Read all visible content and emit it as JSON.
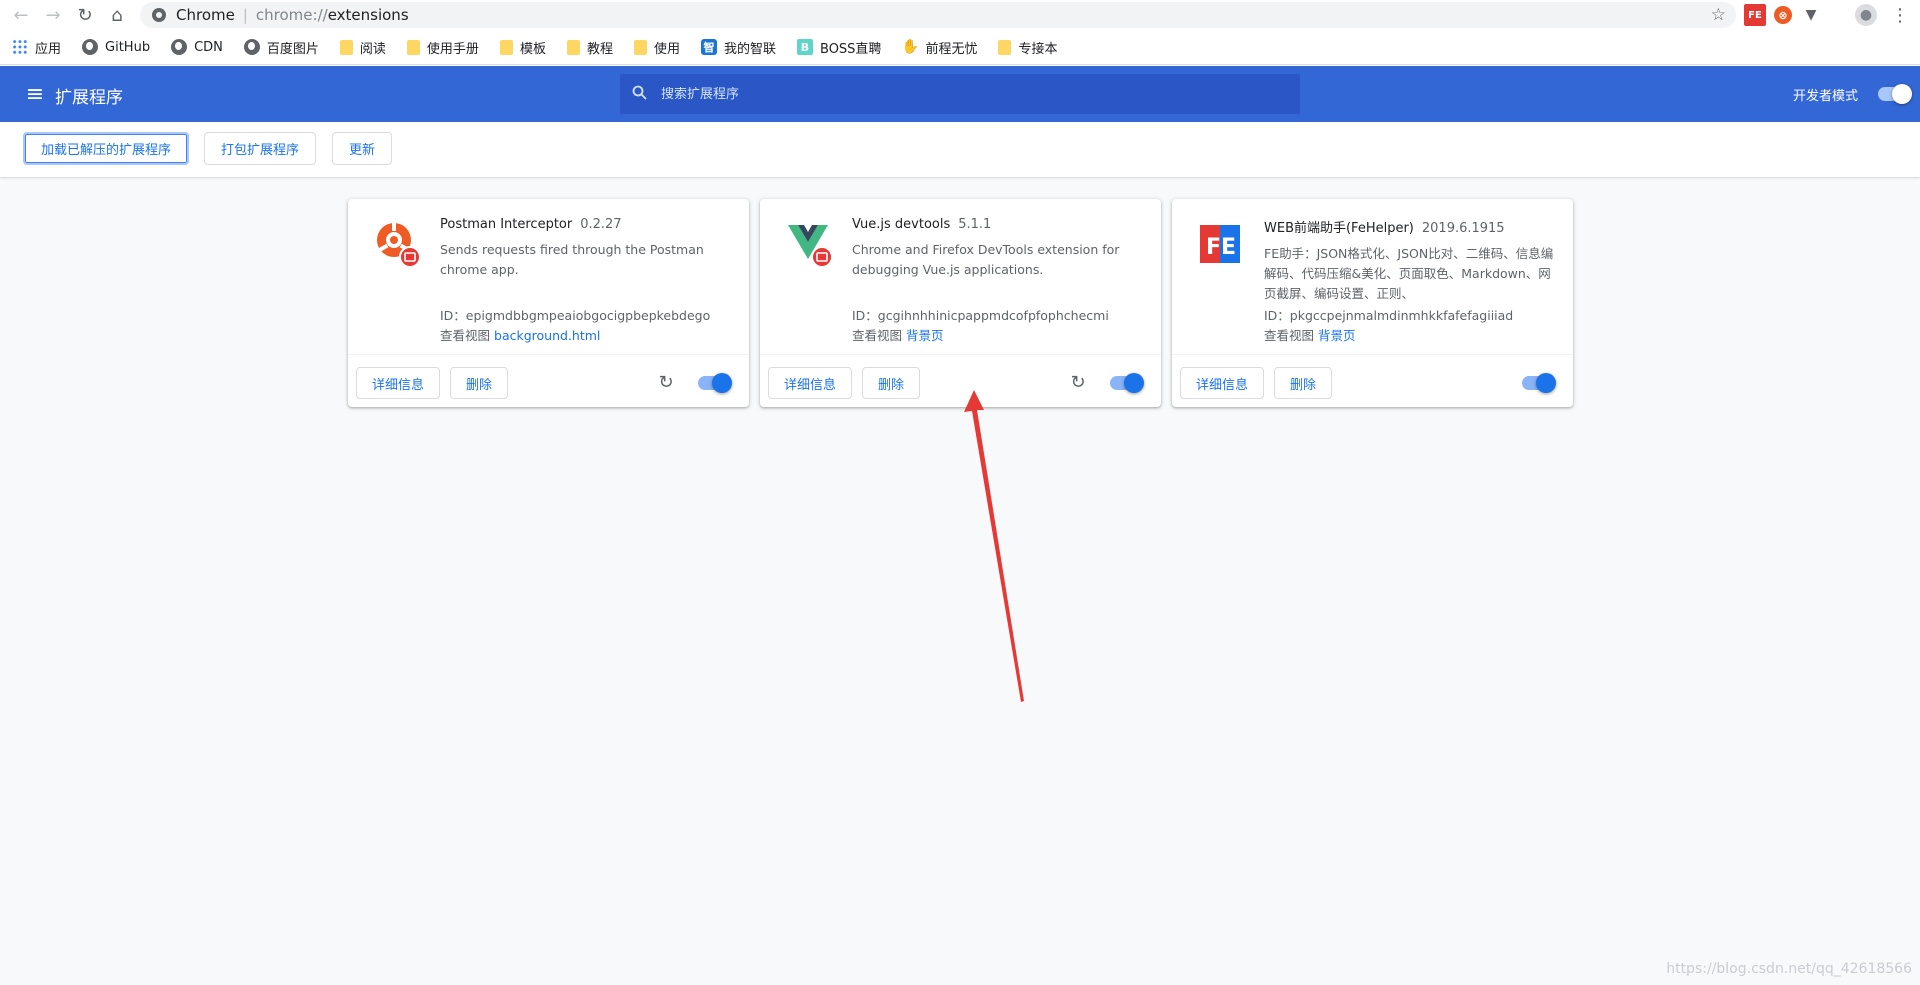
{
  "browser": {
    "nav": {
      "back": "←",
      "forward": "→",
      "reload": "↻",
      "home": "⌂"
    },
    "omnibox": {
      "site": "Chrome",
      "scheme": "chrome://",
      "path": "extensions"
    },
    "bookmark_star": "☆",
    "extension_icons": [
      {
        "name": "fehelper-icon",
        "glyph": "FE"
      },
      {
        "name": "postman-icon",
        "glyph": "⊗"
      },
      {
        "name": "vue-devtools-icon",
        "glyph": "▼"
      }
    ],
    "menu": "⋮"
  },
  "bookmarks": [
    {
      "label": "应用",
      "icon": "apps"
    },
    {
      "label": "GitHub",
      "icon": "globe"
    },
    {
      "label": "CDN",
      "icon": "globe"
    },
    {
      "label": "百度图片",
      "icon": "globe"
    },
    {
      "label": "阅读",
      "icon": "folder"
    },
    {
      "label": "使用手册",
      "icon": "folder"
    },
    {
      "label": "模板",
      "icon": "folder"
    },
    {
      "label": "教程",
      "icon": "folder"
    },
    {
      "label": "使用",
      "icon": "folder"
    },
    {
      "label": "我的智联",
      "icon": "zhilian",
      "glyph": "智"
    },
    {
      "label": "BOSS直聘",
      "icon": "boss",
      "glyph": "B"
    },
    {
      "label": "前程无忧",
      "icon": "hand",
      "glyph": "✋"
    },
    {
      "label": "专接本",
      "icon": "folder"
    }
  ],
  "header": {
    "menu_glyph": "≡",
    "title": "扩展程序",
    "search_placeholder": "搜索扩展程序",
    "dev_mode_label": "开发者模式",
    "dev_mode_on": true
  },
  "toolbar": {
    "load_unpacked": "加载已解压的扩展程序",
    "pack": "打包扩展程序",
    "update": "更新"
  },
  "cards": [
    {
      "name": "Postman Interceptor",
      "version": "0.2.27",
      "description": "Sends requests fired through the Postman chrome app.",
      "id": "ID：epigmdbbgmpeaiobgocigpbepkebdego",
      "views_label": "查看视图",
      "view_link": "background.html",
      "details": "详细信息",
      "remove": "删除",
      "enabled": true,
      "has_reload": true
    },
    {
      "name": "Vue.js devtools",
      "version": "5.1.1",
      "description": "Chrome and Firefox DevTools extension for debugging Vue.js applications.",
      "id": "ID：gcgihnhhinicpappmdcofpfophchecmi",
      "views_label": "查看视图",
      "view_link": "背景页",
      "details": "详细信息",
      "remove": "删除",
      "enabled": true,
      "has_reload": true
    },
    {
      "name": "WEB前端助手(FeHelper)",
      "version": "2019.6.1915",
      "description": "FE助手：JSON格式化、JSON比对、二维码、信息编解码、代码压缩&美化、页面取色、Markdown、网页截屏、编码设置、正则、",
      "id": "ID：pkgccpejnmalmdinmhkkfafefagiiiad",
      "views_label": "查看视图",
      "view_link": "背景页",
      "details": "详细信息",
      "remove": "删除",
      "enabled": true,
      "has_reload": false
    }
  ],
  "annotation_color": "#e53935",
  "watermark": "https://blog.csdn.net/qq_42618566"
}
